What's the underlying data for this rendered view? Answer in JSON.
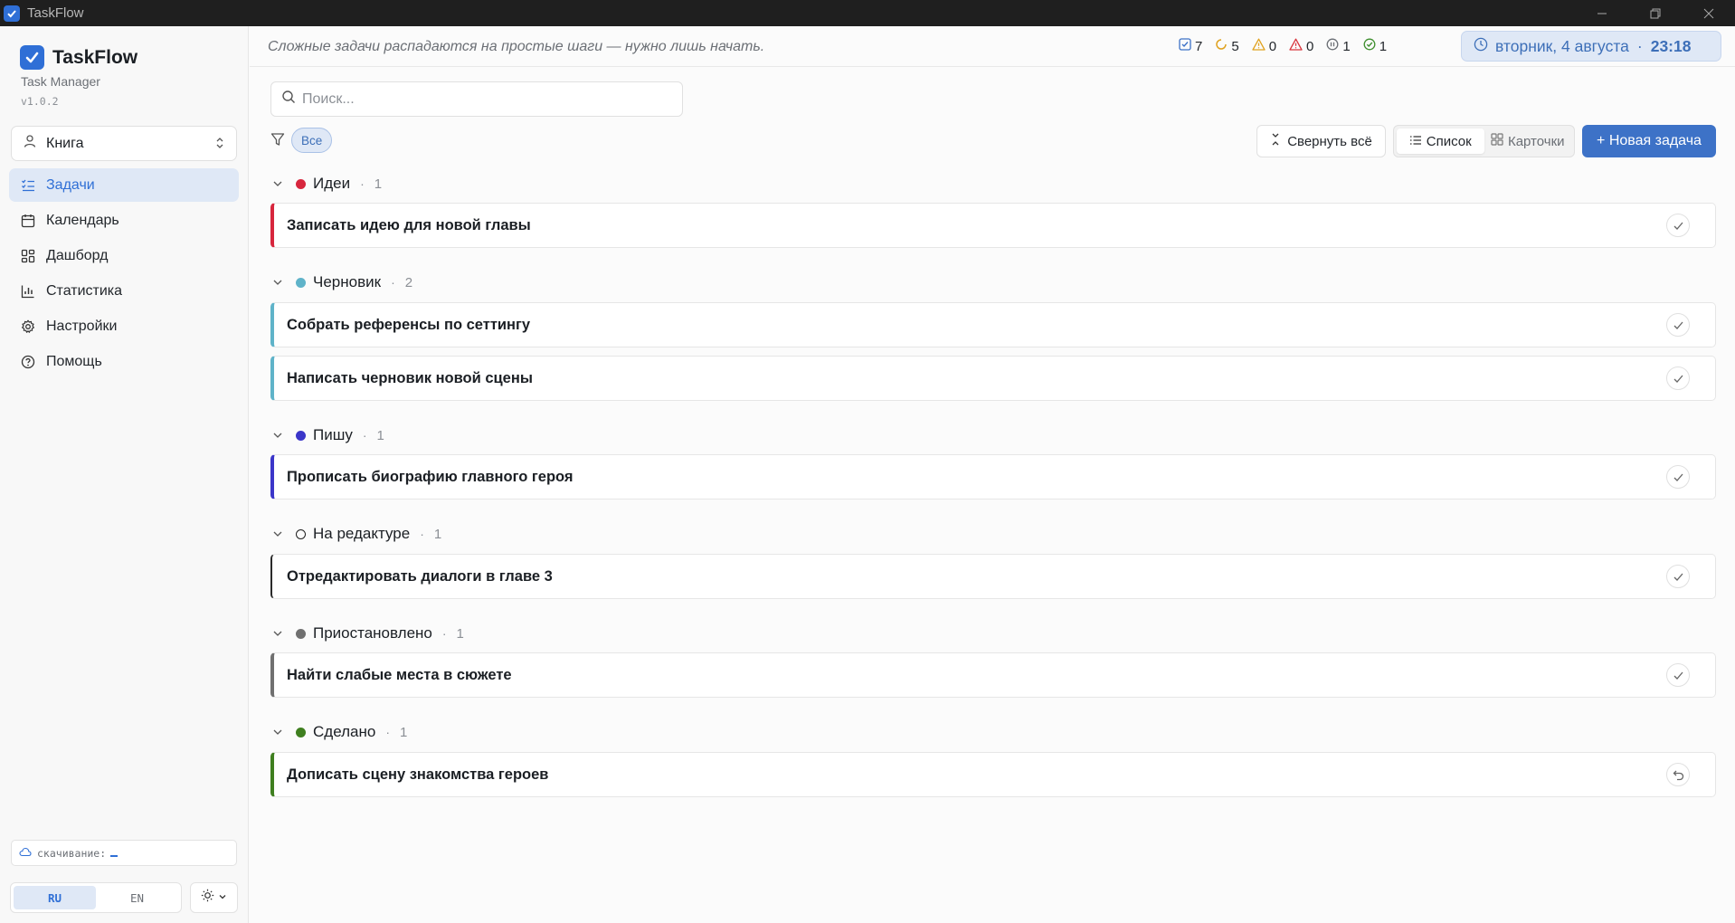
{
  "window": {
    "title": "TaskFlow"
  },
  "sidebar": {
    "brand": "TaskFlow",
    "subtitle": "Task Manager",
    "version": "v1.0.2",
    "workspace": "Книга",
    "nav": [
      {
        "label": "Задачи",
        "icon": "list-check-icon",
        "active": true
      },
      {
        "label": "Календарь",
        "icon": "calendar-icon"
      },
      {
        "label": "Дашборд",
        "icon": "dashboard-icon"
      },
      {
        "label": "Статистика",
        "icon": "chart-icon"
      },
      {
        "label": "Настройки",
        "icon": "gear-icon"
      },
      {
        "label": "Помощь",
        "icon": "help-icon"
      }
    ],
    "download_label": "скачивание:",
    "languages": [
      "RU",
      "EN"
    ],
    "active_language": "RU"
  },
  "header": {
    "quote": "Сложные задачи распадаются на простые шаги — нужно лишь начать.",
    "stats": [
      {
        "icon": "checkbox-icon",
        "value": "7",
        "color": "#3d72c7"
      },
      {
        "icon": "spinner-icon",
        "value": "5",
        "color": "#e0a21f"
      },
      {
        "icon": "warning-icon",
        "value": "0",
        "color": "#e0a21f"
      },
      {
        "icon": "alert-icon",
        "value": "0",
        "color": "#d9363e"
      },
      {
        "icon": "pause-icon",
        "value": "1",
        "color": "#6b6f75"
      },
      {
        "icon": "check-circle-icon",
        "value": "1",
        "color": "#3f8f2f"
      }
    ],
    "date": "вторник, 4 августа",
    "date_sep": "·",
    "time": "23:18"
  },
  "toolbar": {
    "search_placeholder": "Поиск...",
    "filter_chip": "Все",
    "collapse_label": "Свернуть всё",
    "view_list": "Список",
    "view_cards": "Карточки",
    "new_task": "+ Новая задача"
  },
  "groups": [
    {
      "name": "Идеи",
      "count": "1",
      "color": "#d7263d",
      "dot": "filled",
      "tasks": [
        {
          "title": "Записать идею для новой главы",
          "action": "check"
        }
      ]
    },
    {
      "name": "Черновик",
      "count": "2",
      "color": "#5fb3c9",
      "dot": "filled",
      "tasks": [
        {
          "title": "Собрать референсы по сеттингу",
          "action": "check"
        },
        {
          "title": "Написать черновик новой сцены",
          "action": "check"
        }
      ]
    },
    {
      "name": "Пишу",
      "count": "1",
      "color": "#3b36c9",
      "dot": "filled",
      "tasks": [
        {
          "title": "Прописать биографию главного героя",
          "action": "check"
        }
      ]
    },
    {
      "name": "На редактуре",
      "count": "1",
      "color": "#1f1f1f",
      "dot": "outline",
      "tasks": [
        {
          "title": "Отредактировать диалоги в главе 3",
          "action": "check"
        }
      ]
    },
    {
      "name": "Приостановлено",
      "count": "1",
      "color": "#707070",
      "dot": "filled",
      "tasks": [
        {
          "title": "Найти слабые места в сюжете",
          "action": "check"
        }
      ]
    },
    {
      "name": "Сделано",
      "count": "1",
      "color": "#3f7f1f",
      "dot": "filled",
      "tasks": [
        {
          "title": "Дописать сцену знакомства героев",
          "action": "undo"
        }
      ]
    }
  ]
}
